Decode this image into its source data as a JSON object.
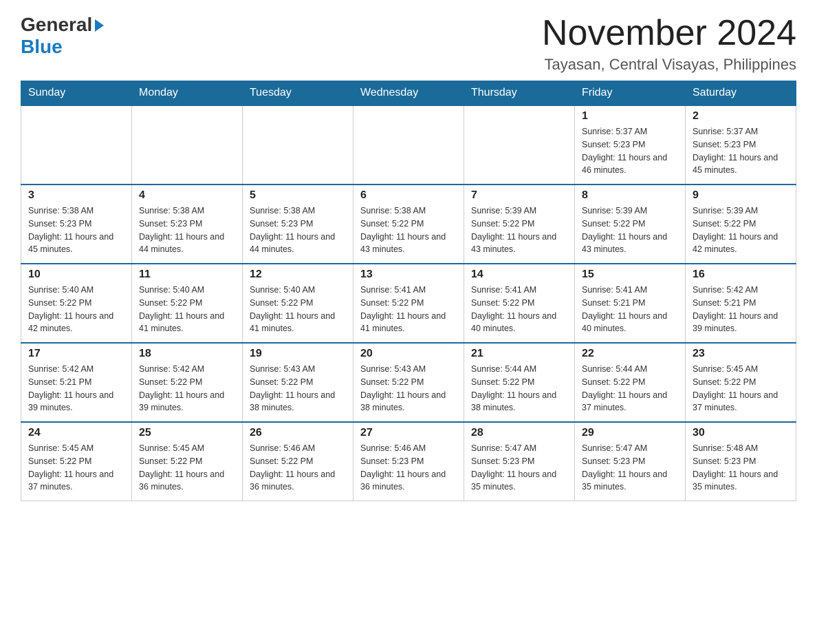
{
  "logo": {
    "general": "General",
    "blue": "Blue"
  },
  "header": {
    "month_title": "November 2024",
    "location": "Tayasan, Central Visayas, Philippines"
  },
  "days_of_week": [
    "Sunday",
    "Monday",
    "Tuesday",
    "Wednesday",
    "Thursday",
    "Friday",
    "Saturday"
  ],
  "weeks": [
    {
      "days": [
        {
          "num": "",
          "info": ""
        },
        {
          "num": "",
          "info": ""
        },
        {
          "num": "",
          "info": ""
        },
        {
          "num": "",
          "info": ""
        },
        {
          "num": "",
          "info": ""
        },
        {
          "num": "1",
          "info": "Sunrise: 5:37 AM\nSunset: 5:23 PM\nDaylight: 11 hours and 46 minutes."
        },
        {
          "num": "2",
          "info": "Sunrise: 5:37 AM\nSunset: 5:23 PM\nDaylight: 11 hours and 45 minutes."
        }
      ]
    },
    {
      "days": [
        {
          "num": "3",
          "info": "Sunrise: 5:38 AM\nSunset: 5:23 PM\nDaylight: 11 hours and 45 minutes."
        },
        {
          "num": "4",
          "info": "Sunrise: 5:38 AM\nSunset: 5:23 PM\nDaylight: 11 hours and 44 minutes."
        },
        {
          "num": "5",
          "info": "Sunrise: 5:38 AM\nSunset: 5:23 PM\nDaylight: 11 hours and 44 minutes."
        },
        {
          "num": "6",
          "info": "Sunrise: 5:38 AM\nSunset: 5:22 PM\nDaylight: 11 hours and 43 minutes."
        },
        {
          "num": "7",
          "info": "Sunrise: 5:39 AM\nSunset: 5:22 PM\nDaylight: 11 hours and 43 minutes."
        },
        {
          "num": "8",
          "info": "Sunrise: 5:39 AM\nSunset: 5:22 PM\nDaylight: 11 hours and 43 minutes."
        },
        {
          "num": "9",
          "info": "Sunrise: 5:39 AM\nSunset: 5:22 PM\nDaylight: 11 hours and 42 minutes."
        }
      ]
    },
    {
      "days": [
        {
          "num": "10",
          "info": "Sunrise: 5:40 AM\nSunset: 5:22 PM\nDaylight: 11 hours and 42 minutes."
        },
        {
          "num": "11",
          "info": "Sunrise: 5:40 AM\nSunset: 5:22 PM\nDaylight: 11 hours and 41 minutes."
        },
        {
          "num": "12",
          "info": "Sunrise: 5:40 AM\nSunset: 5:22 PM\nDaylight: 11 hours and 41 minutes."
        },
        {
          "num": "13",
          "info": "Sunrise: 5:41 AM\nSunset: 5:22 PM\nDaylight: 11 hours and 41 minutes."
        },
        {
          "num": "14",
          "info": "Sunrise: 5:41 AM\nSunset: 5:22 PM\nDaylight: 11 hours and 40 minutes."
        },
        {
          "num": "15",
          "info": "Sunrise: 5:41 AM\nSunset: 5:21 PM\nDaylight: 11 hours and 40 minutes."
        },
        {
          "num": "16",
          "info": "Sunrise: 5:42 AM\nSunset: 5:21 PM\nDaylight: 11 hours and 39 minutes."
        }
      ]
    },
    {
      "days": [
        {
          "num": "17",
          "info": "Sunrise: 5:42 AM\nSunset: 5:21 PM\nDaylight: 11 hours and 39 minutes."
        },
        {
          "num": "18",
          "info": "Sunrise: 5:42 AM\nSunset: 5:22 PM\nDaylight: 11 hours and 39 minutes."
        },
        {
          "num": "19",
          "info": "Sunrise: 5:43 AM\nSunset: 5:22 PM\nDaylight: 11 hours and 38 minutes."
        },
        {
          "num": "20",
          "info": "Sunrise: 5:43 AM\nSunset: 5:22 PM\nDaylight: 11 hours and 38 minutes."
        },
        {
          "num": "21",
          "info": "Sunrise: 5:44 AM\nSunset: 5:22 PM\nDaylight: 11 hours and 38 minutes."
        },
        {
          "num": "22",
          "info": "Sunrise: 5:44 AM\nSunset: 5:22 PM\nDaylight: 11 hours and 37 minutes."
        },
        {
          "num": "23",
          "info": "Sunrise: 5:45 AM\nSunset: 5:22 PM\nDaylight: 11 hours and 37 minutes."
        }
      ]
    },
    {
      "days": [
        {
          "num": "24",
          "info": "Sunrise: 5:45 AM\nSunset: 5:22 PM\nDaylight: 11 hours and 37 minutes."
        },
        {
          "num": "25",
          "info": "Sunrise: 5:45 AM\nSunset: 5:22 PM\nDaylight: 11 hours and 36 minutes."
        },
        {
          "num": "26",
          "info": "Sunrise: 5:46 AM\nSunset: 5:22 PM\nDaylight: 11 hours and 36 minutes."
        },
        {
          "num": "27",
          "info": "Sunrise: 5:46 AM\nSunset: 5:23 PM\nDaylight: 11 hours and 36 minutes."
        },
        {
          "num": "28",
          "info": "Sunrise: 5:47 AM\nSunset: 5:23 PM\nDaylight: 11 hours and 35 minutes."
        },
        {
          "num": "29",
          "info": "Sunrise: 5:47 AM\nSunset: 5:23 PM\nDaylight: 11 hours and 35 minutes."
        },
        {
          "num": "30",
          "info": "Sunrise: 5:48 AM\nSunset: 5:23 PM\nDaylight: 11 hours and 35 minutes."
        }
      ]
    }
  ]
}
